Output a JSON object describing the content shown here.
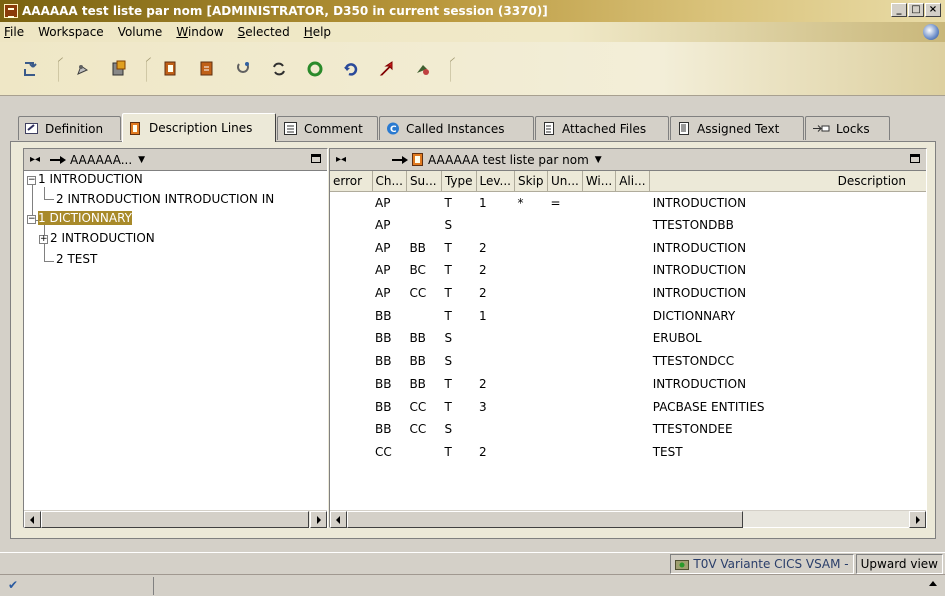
{
  "window": {
    "title": "AAAAAA test liste par nom [ADMINISTRATOR, D350 in current session (3370)]",
    "controls": [
      "_",
      "□",
      "×"
    ]
  },
  "menu": [
    {
      "label": "File",
      "u": "F",
      "rest": "ile"
    },
    {
      "label": "Workspace",
      "u": "",
      "rest": "Workspace"
    },
    {
      "label": "Volume",
      "u": "",
      "rest": "Volume"
    },
    {
      "label": "Window",
      "u": "W",
      "rest": "indow"
    },
    {
      "label": "Selected",
      "u": "S",
      "rest": "elected"
    },
    {
      "label": "Help",
      "u": "H",
      "rest": "elp"
    }
  ],
  "toolbar": {
    "icons": [
      "cut-paste-icon",
      "edit-icon",
      "save-icon",
      "copy-icon",
      "document-icon",
      "refresh-link-icon",
      "reload-icon",
      "green-cycle-icon",
      "undo-icon",
      "red-arrow-icon",
      "tool-icon"
    ]
  },
  "tabs": [
    {
      "label": "Definition",
      "icon": "definition-icon",
      "active": false
    },
    {
      "label": "Description Lines",
      "icon": "description-lines-icon",
      "active": true
    },
    {
      "label": "Comment",
      "icon": "comment-icon",
      "active": false
    },
    {
      "label": "Called Instances",
      "icon": "called-instances-icon",
      "active": false
    },
    {
      "label": "Attached Files",
      "icon": "attached-files-icon",
      "active": false
    },
    {
      "label": "Assigned Text",
      "icon": "assigned-text-icon",
      "active": false
    },
    {
      "label": "Locks",
      "icon": "locks-icon",
      "active": false
    }
  ],
  "left_pane": {
    "nav_label": "AAAAAA...",
    "tree": [
      {
        "label": "1 INTRODUCTION",
        "selected": false
      },
      {
        "label": "2 INTRODUCTION INTRODUCTION IN",
        "selected": false
      },
      {
        "label": "1 DICTIONNARY",
        "selected": true
      },
      {
        "label": "2 INTRODUCTION",
        "selected": false
      },
      {
        "label": "2 TEST",
        "selected": false
      }
    ]
  },
  "right_pane": {
    "nav_label": "AAAAAA test liste par nom",
    "columns": [
      "error",
      "Ch...",
      "Su...",
      "Type",
      "Lev...",
      "Skip",
      "Un...",
      "Wi...",
      "Ali...",
      "Description"
    ],
    "rows": [
      [
        "",
        "AP",
        "",
        "T",
        "1",
        "*",
        "=",
        "",
        "",
        "INTRODUCTION"
      ],
      [
        "",
        "AP",
        "",
        "S",
        "",
        "",
        "",
        "",
        "",
        "TTESTONDBB"
      ],
      [
        "",
        "AP",
        "BB",
        "T",
        "2",
        "",
        "",
        "",
        "",
        "INTRODUCTION"
      ],
      [
        "",
        "AP",
        "BC",
        "T",
        "2",
        "",
        "",
        "",
        "",
        "INTRODUCTION"
      ],
      [
        "",
        "AP",
        "CC",
        "T",
        "2",
        "",
        "",
        "",
        "",
        "INTRODUCTION"
      ],
      [
        "",
        "BB",
        "",
        "T",
        "1",
        "",
        "",
        "",
        "",
        "DICTIONNARY"
      ],
      [
        "",
        "BB",
        "BB",
        "S",
        "",
        "",
        "",
        "",
        "",
        "ERUBOL"
      ],
      [
        "",
        "BB",
        "BB",
        "S",
        "",
        "",
        "",
        "",
        "",
        "TTESTONDCC"
      ],
      [
        "",
        "BB",
        "BB",
        "T",
        "2",
        "",
        "",
        "",
        "",
        "INTRODUCTION"
      ],
      [
        "",
        "BB",
        "CC",
        "T",
        "3",
        "",
        "",
        "",
        "",
        "PACBASE ENTITIES"
      ],
      [
        "",
        "BB",
        "CC",
        "S",
        "",
        "",
        "",
        "",
        "",
        "TTESTONDEE"
      ],
      [
        "",
        "CC",
        "",
        "T",
        "2",
        "",
        "",
        "",
        "",
        "TEST"
      ]
    ]
  },
  "status": {
    "variant": "T0V Variante CICS VSAM -",
    "view": "Upward view"
  }
}
